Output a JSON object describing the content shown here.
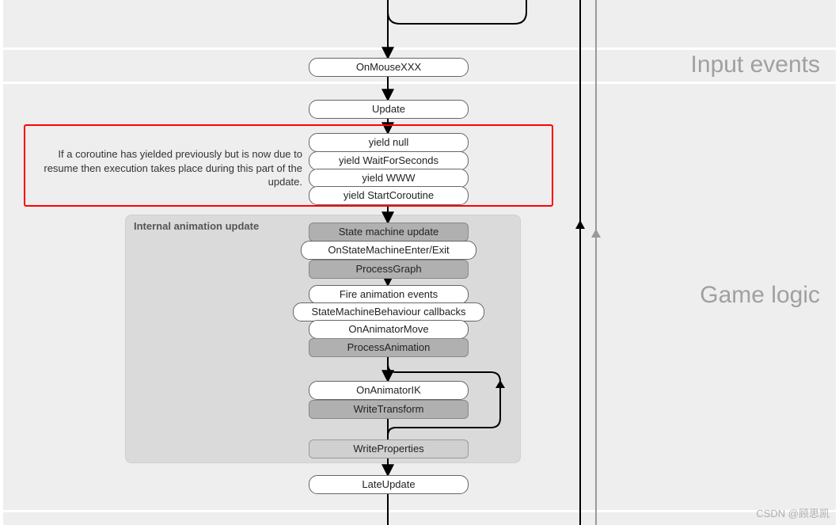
{
  "bands": {
    "input_events": {
      "label": "Input events"
    },
    "game_logic": {
      "label": "Game logic"
    }
  },
  "nodes": {
    "on_mouse": "OnMouseXXX",
    "update": "Update",
    "yield_null": "yield null",
    "yield_wfs": "yield WaitForSeconds",
    "yield_www": "yield WWW",
    "yield_sc": "yield StartCoroutine",
    "sm_update": "State machine update",
    "on_sm_ee": "OnStateMachineEnter/Exit",
    "process_graph": "ProcessGraph",
    "fire_anim": "Fire animation events",
    "smb_cb": "StateMachineBehaviour callbacks",
    "on_anim_move": "OnAnimatorMove",
    "process_anim": "ProcessAnimation",
    "on_anim_ik": "OnAnimatorIK",
    "write_xform": "WriteTransform",
    "write_props": "WriteProperties",
    "late_update": "LateUpdate"
  },
  "panels": {
    "anim_update": "Internal animation update"
  },
  "notes": {
    "coroutine": "If a coroutine has yielded previously but is now due to resume then execution takes place during this part of the update."
  },
  "watermark": "CSDN @顾思凯"
}
